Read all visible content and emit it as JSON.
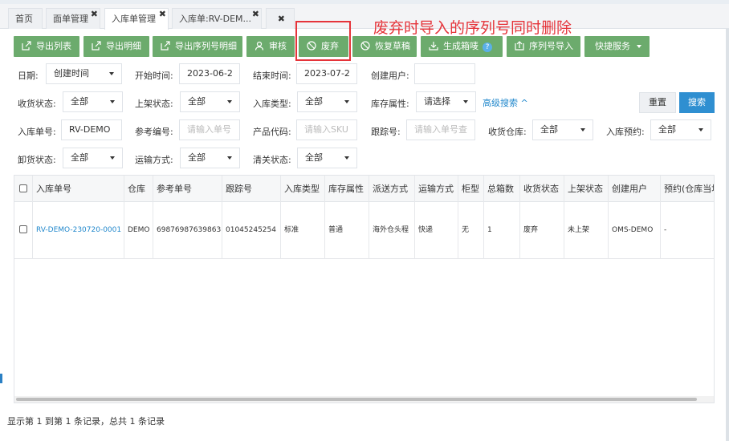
{
  "tabs": [
    {
      "label": "首页",
      "closable": false
    },
    {
      "label": "面单管理",
      "closable": true
    },
    {
      "label": "入库单管理",
      "closable": true,
      "active": true
    },
    {
      "label": "入库单:RV-DEM...",
      "closable": true
    },
    {
      "label": "",
      "closable": true
    }
  ],
  "toolbar": {
    "export_list": "导出列表",
    "export_detail": "导出明细",
    "export_serial_detail": "导出序列号明细",
    "audit": "审核",
    "discard": "废弃",
    "restore_draft": "恢复草稿",
    "generate_box_label": "生成箱唛",
    "serial_import": "序列号导入",
    "quick_service": "快捷服务"
  },
  "annotation": "废弃时导入的序列号同时删除",
  "filters": {
    "date_label": "日期:",
    "date_type": "创建时间",
    "start_label": "开始时间:",
    "start_value": "2023-06-2",
    "end_label": "结束时间:",
    "end_value": "2023-07-2",
    "creator_label": "创建用户:",
    "creator_value": "",
    "receive_status_label": "收货状态:",
    "receive_status_value": "全部",
    "shelf_status_label": "上架状态:",
    "shelf_status_value": "全部",
    "inbound_type_label": "入库类型:",
    "inbound_type_value": "全部",
    "stock_attr_label": "库存属性:",
    "stock_attr_value": "请选择",
    "advanced_search": "高级搜索 ^",
    "reset": "重置",
    "search": "搜索",
    "inbound_no_label": "入库单号:",
    "inbound_no_value": "RV-DEMO",
    "ref_no_label": "参考编号:",
    "ref_no_placeholder": "请输入单号",
    "product_code_label": "产品代码:",
    "product_code_placeholder": "请输入SKU",
    "tracking_label": "跟踪号:",
    "tracking_placeholder": "请输入单号查",
    "receive_wh_label": "收货仓库:",
    "receive_wh_value": "全部",
    "reservation_label": "入库预约:",
    "reservation_value": "全部",
    "unload_status_label": "卸货状态:",
    "unload_status_value": "全部",
    "transport_label": "运输方式:",
    "transport_value": "全部",
    "customs_label": "清关状态:",
    "customs_value": "全部"
  },
  "table": {
    "headers": [
      "入库单号",
      "仓库",
      "参考单号",
      "跟踪号",
      "入库类型",
      "库存属性",
      "派送方式",
      "运输方式",
      "柜型",
      "总箱数",
      "收货状态",
      "上架状态",
      "创建用户",
      "预约(仓库当地"
    ],
    "rows": [
      [
        "RV-DEMO-230720-0001",
        "DEMO",
        "69876987639863",
        "01045245254",
        "标准",
        "普通",
        "海外仓头程",
        "快递",
        "无",
        "1",
        "废弃",
        "未上架",
        "OMS-DEMO",
        "-"
      ]
    ]
  },
  "footer": "显示第 1 到第 1 条记录，总共 1 条记录"
}
